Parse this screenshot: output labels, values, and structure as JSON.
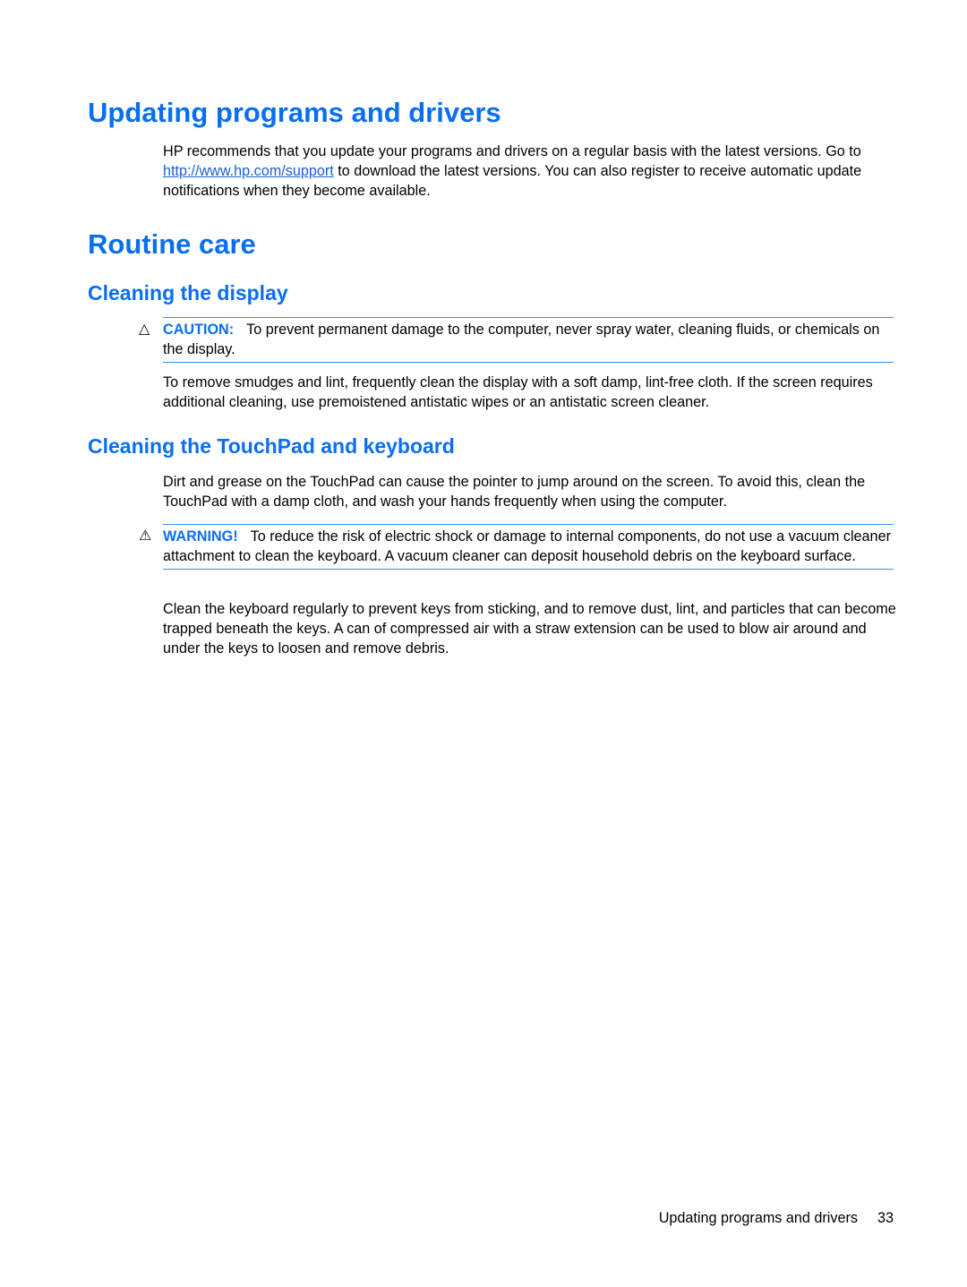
{
  "sections": {
    "updating": {
      "title": "Updating programs and drivers",
      "para_before_link": "HP recommends that you update your programs and drivers on a regular basis with the latest versions. Go to ",
      "link_text": "http://www.hp.com/support",
      "para_after_link": " to download the latest versions. You can also register to receive automatic update notifications when they become available."
    },
    "routine_care": {
      "title": "Routine care"
    },
    "cleaning_display": {
      "title": "Cleaning the display",
      "caution_icon": "caution-triangle-icon",
      "caution_label": "CAUTION:",
      "caution_text": "To prevent permanent damage to the computer, never spray water, cleaning fluids, or chemicals on the display.",
      "body": "To remove smudges and lint, frequently clean the display with a soft damp, lint-free cloth. If the screen requires additional cleaning, use premoistened antistatic wipes or an antistatic screen cleaner."
    },
    "cleaning_touchpad": {
      "title": "Cleaning the TouchPad and keyboard",
      "intro": "Dirt and grease on the TouchPad can cause the pointer to jump around on the screen. To avoid this, clean the TouchPad with a damp cloth, and wash your hands frequently when using the computer.",
      "warning_icon": "warning-triangle-icon",
      "warning_label": "WARNING!",
      "warning_text": "To reduce the risk of electric shock or damage to internal components, do not use a vacuum cleaner attachment to clean the keyboard. A vacuum cleaner can deposit household debris on the keyboard surface.",
      "body": "Clean the keyboard regularly to prevent keys from sticking, and to remove dust, lint, and particles that can become trapped beneath the keys. A can of compressed air with a straw extension can be used to blow air around and under the keys to loosen and remove debris."
    }
  },
  "footer": {
    "section_title": "Updating programs and drivers",
    "page_number": "33"
  }
}
